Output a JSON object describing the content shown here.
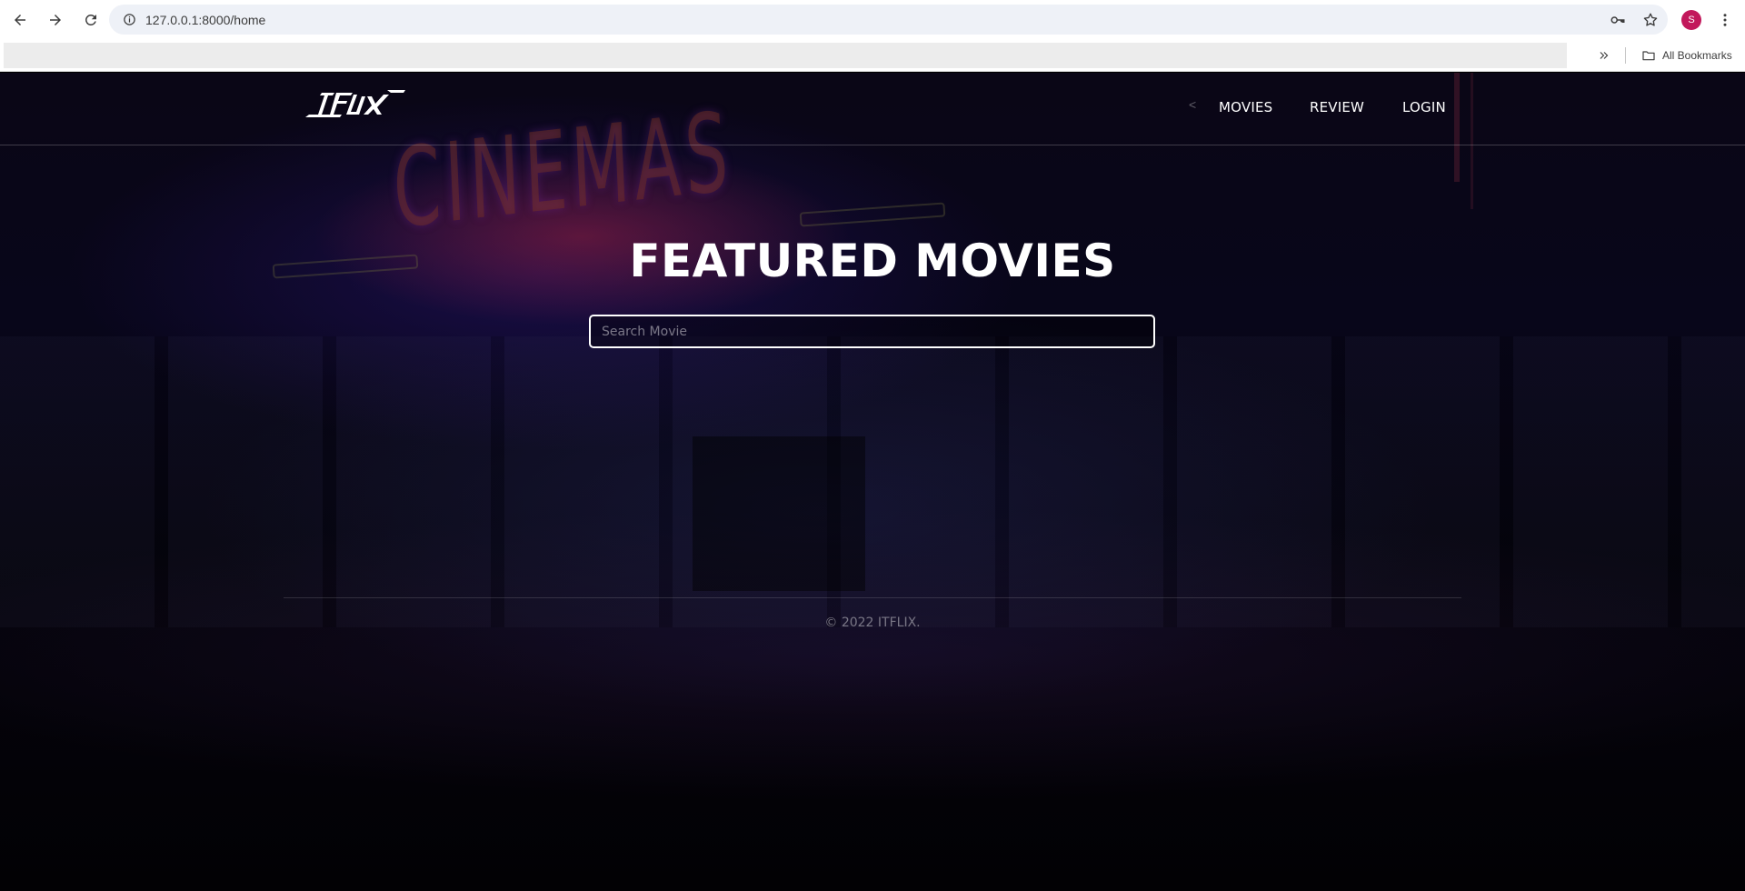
{
  "browser": {
    "url": "127.0.0.1:8000/home",
    "profile_initial": "S",
    "bookmarks_label": "All Bookmarks",
    "accent_color": "#c2185b"
  },
  "site": {
    "logo_text": "ITFLIX",
    "nav_prev": "<",
    "nav": {
      "movies": "MOVIES",
      "review": "REVIEW",
      "login": "LOGIN"
    },
    "hero_title": "FEATURED MOVIES",
    "search": {
      "placeholder": "Search Movie",
      "value": ""
    },
    "footer": "© 2022 ITFLIX."
  }
}
